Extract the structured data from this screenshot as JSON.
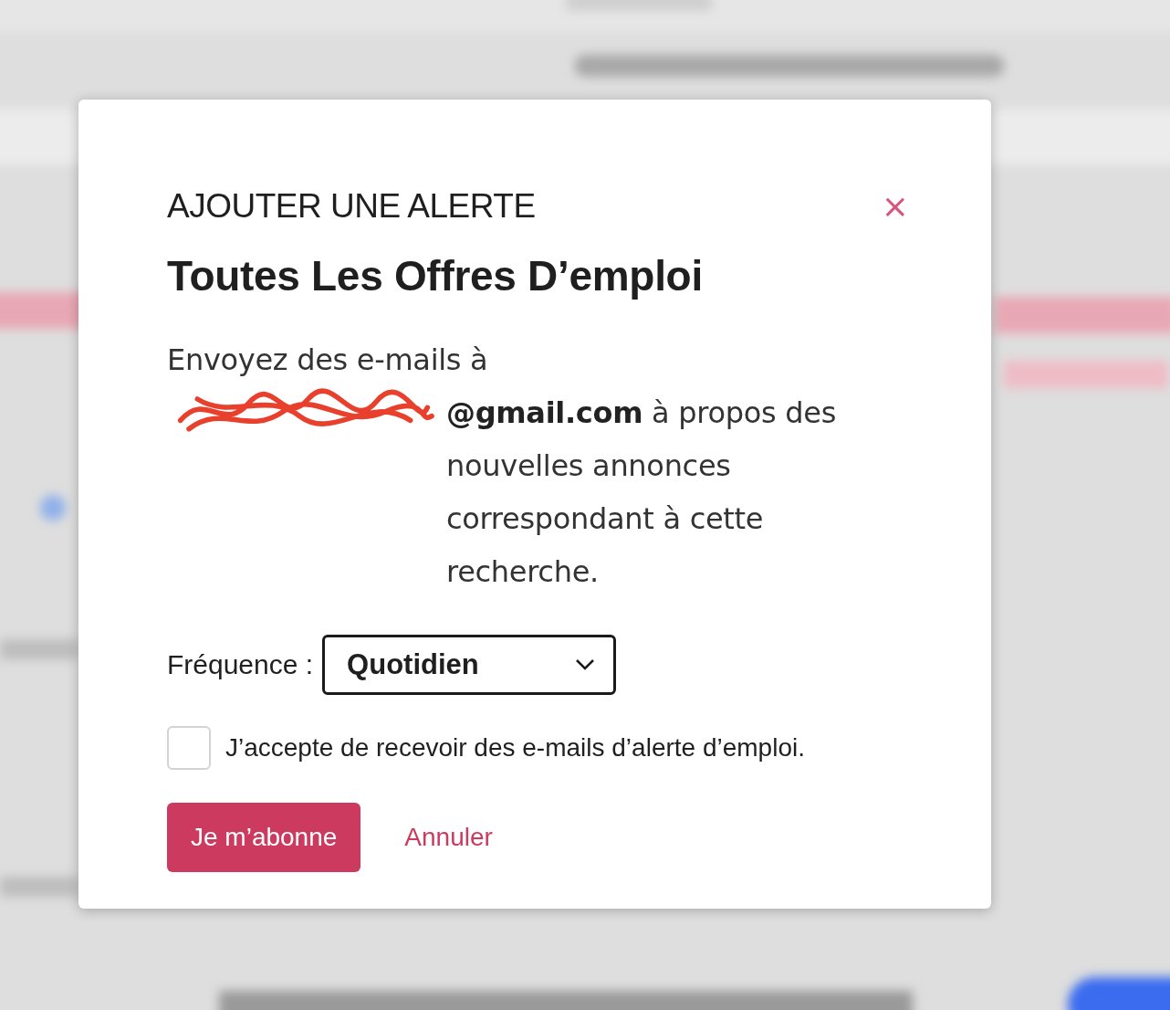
{
  "dialog": {
    "kicker": "AJOUTER UNE ALERTE",
    "close": "×",
    "title": "Toutes Les Offres D’emploi",
    "message_intro": "Envoyez des e-mails à",
    "message": "**@gmail.com** à propos des nouvelles annonces correspondant à cette recherche.",
    "frequency": {
      "label": "Fréquence :",
      "value": "Quotidien"
    },
    "consent": {
      "label": "J’accepte de recevoir des e-mails d’alerte d’emploi.",
      "checked": false
    },
    "buttons": [
      {
        "label": "Je m’abonne",
        "kind": "primary"
      },
      {
        "label": "Annuler",
        "kind": "link"
      }
    ]
  }
}
